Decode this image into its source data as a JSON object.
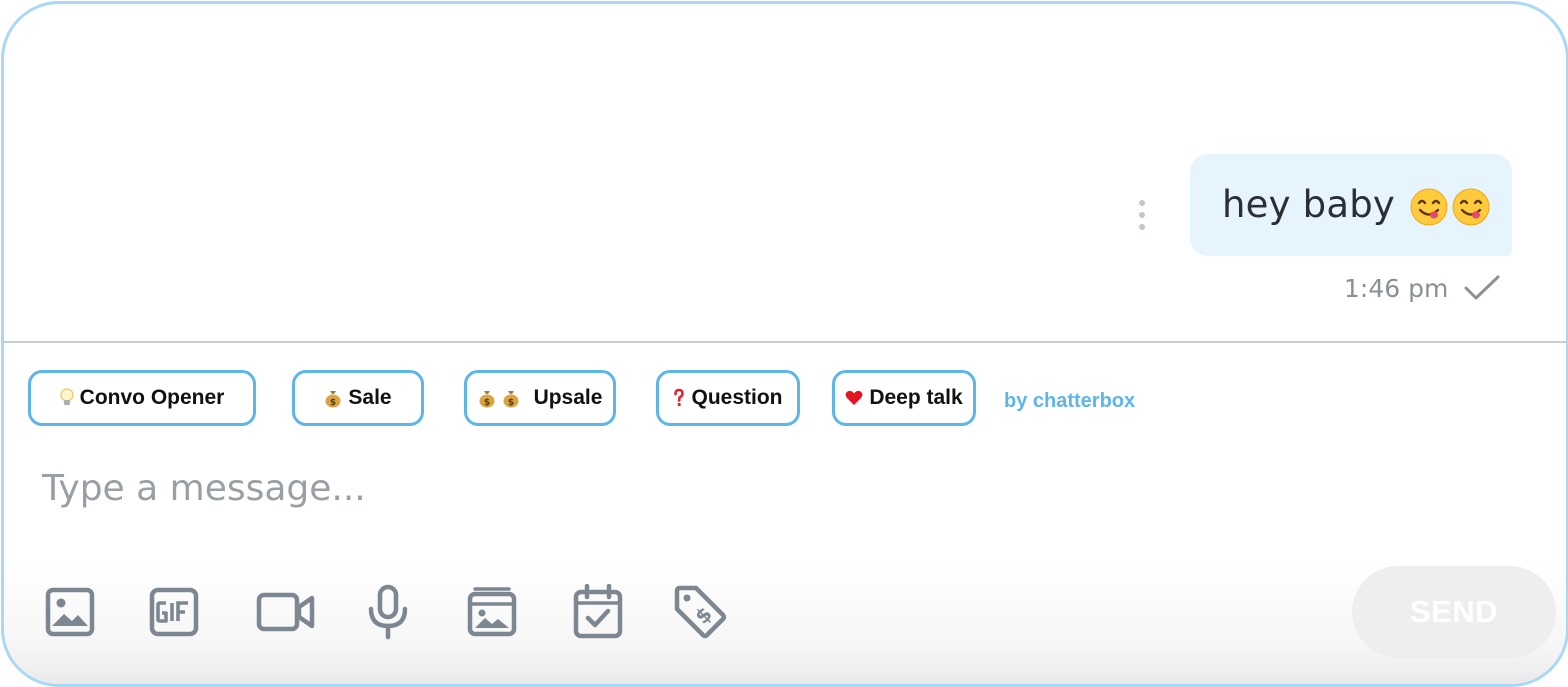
{
  "message": {
    "text": "hey baby",
    "emojis": [
      "yum-emoji",
      "yum-emoji"
    ],
    "time": "1:46 pm",
    "status": "sent"
  },
  "quick_replies": [
    {
      "label": "Convo Opener",
      "icon": "lightbulb-icon"
    },
    {
      "label": "Sale",
      "icon": "money-bag-icon"
    },
    {
      "label": "Upsale",
      "icon": "money-bag-icon"
    },
    {
      "label": "Question",
      "icon": "question-mark-icon"
    },
    {
      "label": "Deep talk",
      "icon": "heart-icon"
    }
  ],
  "attribution": "by chatterbox",
  "composer": {
    "placeholder": "Type a message...",
    "send_label": "SEND"
  },
  "toolbar": [
    "image-icon",
    "gif-icon",
    "video-icon",
    "microphone-icon",
    "vault-icon",
    "schedule-icon",
    "price-tag-icon"
  ],
  "colors": {
    "accent": "#5db5ea",
    "bubble": "#e6f5fd",
    "icon_gray": "#7d8791",
    "frame_border": "#a9d8f5"
  }
}
